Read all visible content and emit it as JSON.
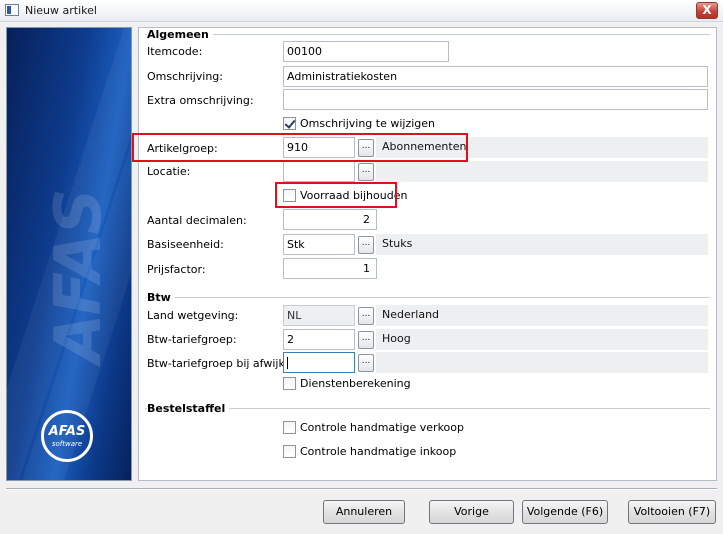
{
  "window": {
    "title": "Nieuw artikel",
    "close_glyph": "X"
  },
  "banner": {
    "watermark": "AFAS",
    "logo_main": "AFAS",
    "logo_sub": "software"
  },
  "sections": {
    "algemeen": "Algemeen",
    "btw": "Btw",
    "bestelstaffel": "Bestelstaffel"
  },
  "fields": {
    "itemcode": {
      "label": "Itemcode:",
      "value": "00100"
    },
    "omschrijving": {
      "label": "Omschrijving:",
      "value": "Administratiekosten"
    },
    "extra_omschrijving": {
      "label": "Extra omschrijving:",
      "value": ""
    },
    "omschrijving_te_wijzigen": {
      "label": "Omschrijving te wijzigen",
      "checked": true
    },
    "artikelgroep": {
      "label": "Artikelgroep:",
      "value": "910",
      "description": "Abonnementen"
    },
    "locatie": {
      "label": "Locatie:",
      "value": "",
      "description": ""
    },
    "voorraad_bijhouden": {
      "label": "Voorraad bijhouden",
      "checked": false
    },
    "aantal_decimalen": {
      "label": "Aantal decimalen:",
      "value": "2"
    },
    "basiseenheid": {
      "label": "Basiseenheid:",
      "value": "Stk",
      "description": "Stuks"
    },
    "prijsfactor": {
      "label": "Prijsfactor:",
      "value": "1"
    },
    "land_wetgeving": {
      "label": "Land wetgeving:",
      "value": "NL",
      "description": "Nederland"
    },
    "btw_tariefgroep": {
      "label": "Btw-tariefgroep:",
      "value": "2",
      "description": "Hoog"
    },
    "btw_tariefgroep_afwijking": {
      "label": "Btw-tariefgroep bij afwijking:",
      "value": "",
      "description": ""
    },
    "dienstenberekening": {
      "label": "Dienstenberekening",
      "checked": false
    },
    "controle_verkoop": {
      "label": "Controle handmatige verkoop",
      "checked": false
    },
    "controle_inkoop": {
      "label": "Controle handmatige inkoop",
      "checked": false
    }
  },
  "lookup_glyph": "...",
  "buttons": {
    "annuleren": "Annuleren",
    "vorige": "Vorige",
    "volgende": "Volgende (F6)",
    "voltooien": "Voltooien (F7)"
  },
  "colors": {
    "highlight": "#e0101a",
    "banner": "#0e3c8e"
  }
}
